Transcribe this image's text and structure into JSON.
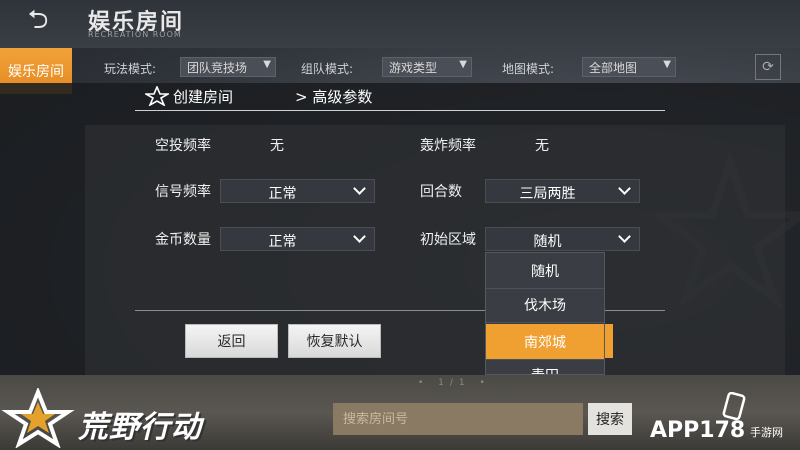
{
  "header": {
    "title": "娱乐房间",
    "subtitle": "RECREATION ROOM",
    "side_tab": "娱乐房间"
  },
  "filters": {
    "mode_label": "玩法模式:",
    "mode_value": "团队竞技场",
    "team_label": "组队模式:",
    "team_value": "游戏类型",
    "map_label": "地图模式:",
    "map_value": "全部地图"
  },
  "modal": {
    "crumb_1": "创建房间",
    "crumb_2": "> 高级参数",
    "rows": {
      "airdrop_label": "空投频率",
      "airdrop_value": "无",
      "bomb_label": "轰炸频率",
      "bomb_value": "无",
      "signal_label": "信号频率",
      "signal_value": "正常",
      "rounds_label": "回合数",
      "rounds_value": "三局两胜",
      "gold_label": "金币数量",
      "gold_value": "正常",
      "zone_label": "初始区域",
      "zone_value": "随机"
    },
    "zone_options": [
      "随机",
      "伐木场",
      "南郊城",
      "麦田"
    ],
    "zone_selected_index": 2,
    "back_button": "返回",
    "reset_button": "恢复默认"
  },
  "bottom": {
    "pager": "• 1/1 •",
    "search_placeholder": "搜索房间号",
    "search_button": "搜索",
    "game_logo": "荒野行动",
    "watermark": "APP178",
    "watermark_sub": "手游网"
  },
  "colors": {
    "accent": "#f0a030",
    "modal_bg": "#1a1c20",
    "dropdown_bg": "#35383e"
  }
}
